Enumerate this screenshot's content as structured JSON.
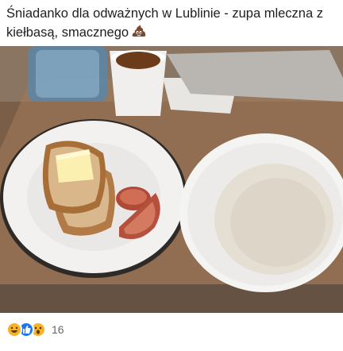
{
  "post": {
    "text": "Śniadanko dla odważnych w Lublinie - zupa mleczna z kiełbasą, smacznego",
    "trailing_emoji": "pile-of-poo"
  },
  "photo": {
    "subject": "breakfast-plate-photo"
  },
  "reactions": {
    "types": [
      "haha",
      "like",
      "wow"
    ],
    "count": "16"
  }
}
